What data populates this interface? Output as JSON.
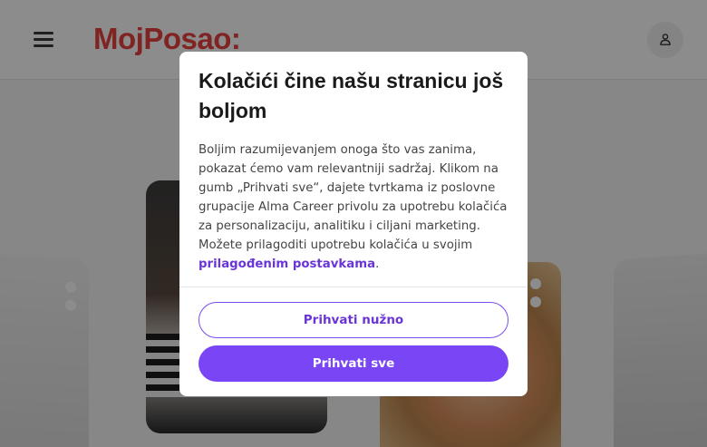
{
  "header": {
    "logo_text": "MojPosao:",
    "menu_icon": "hamburger-menu-icon",
    "user_icon": "user-icon"
  },
  "cookie_dialog": {
    "title": "Kolačići čine našu stranicu još boljom",
    "body_text": "Boljim razumijevanjem onoga što vas zanima, pokazat ćemo vam relevantniji sadržaj. Klikom na gumb „Prihvati sve“, dajete tvrtkama iz poslovne grupacije Alma Career privolu za upotrebu kolačića za personalizaciju, analitiku i ciljani marketing. Možete prilagoditi upotrebu kolačića u svojim ",
    "custom_settings_link": "prilagođenim postavkama",
    "body_end": ".",
    "accept_necessary_label": "Prihvati nužno",
    "accept_all_label": "Prihvati sve"
  },
  "colors": {
    "brand_red": "#e8423f",
    "accent_purple": "#7a45f5",
    "link_purple": "#6a35d6"
  }
}
